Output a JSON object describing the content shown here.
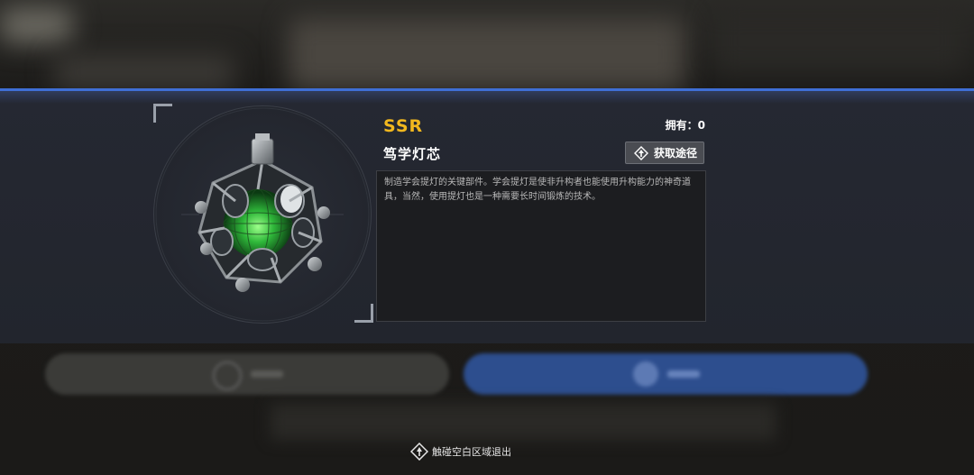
{
  "item": {
    "rarity": "SSR",
    "name": "笃学灯芯",
    "owned_label": "拥有：0",
    "obtain_button": "获取途径",
    "description": "制造学会提灯的关键部件。学会提灯是使非升构者也能使用升构能力的神奇道具，当然，使用提灯也是一种需要长时间锻炼的技术。"
  },
  "footer": {
    "exit_hint": "触碰空白区域退出"
  },
  "colors": {
    "accent_blue": "#3f6fd6",
    "rarity_gold": "#f2b81e",
    "core_green": "#3ecf4a"
  }
}
